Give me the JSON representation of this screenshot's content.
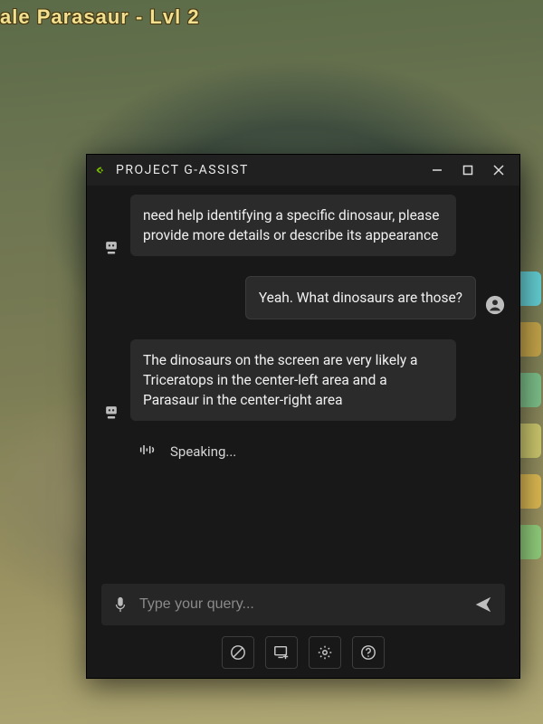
{
  "game": {
    "entity_label": "ale Parasaur - Lvl 2"
  },
  "window": {
    "title": "PROJECT G-ASSIST"
  },
  "chat": {
    "messages": [
      {
        "role": "assistant",
        "text": "need help identifying a specific dinosaur, please provide more details or describe its appearance"
      },
      {
        "role": "user",
        "text": "Yeah. What dinosaurs are those?"
      },
      {
        "role": "assistant",
        "text": "The dinosaurs on the screen are very likely a Triceratops in the center-left area and a Parasaur in the center-right area"
      }
    ],
    "status": "Speaking..."
  },
  "input": {
    "placeholder": "Type your query..."
  }
}
